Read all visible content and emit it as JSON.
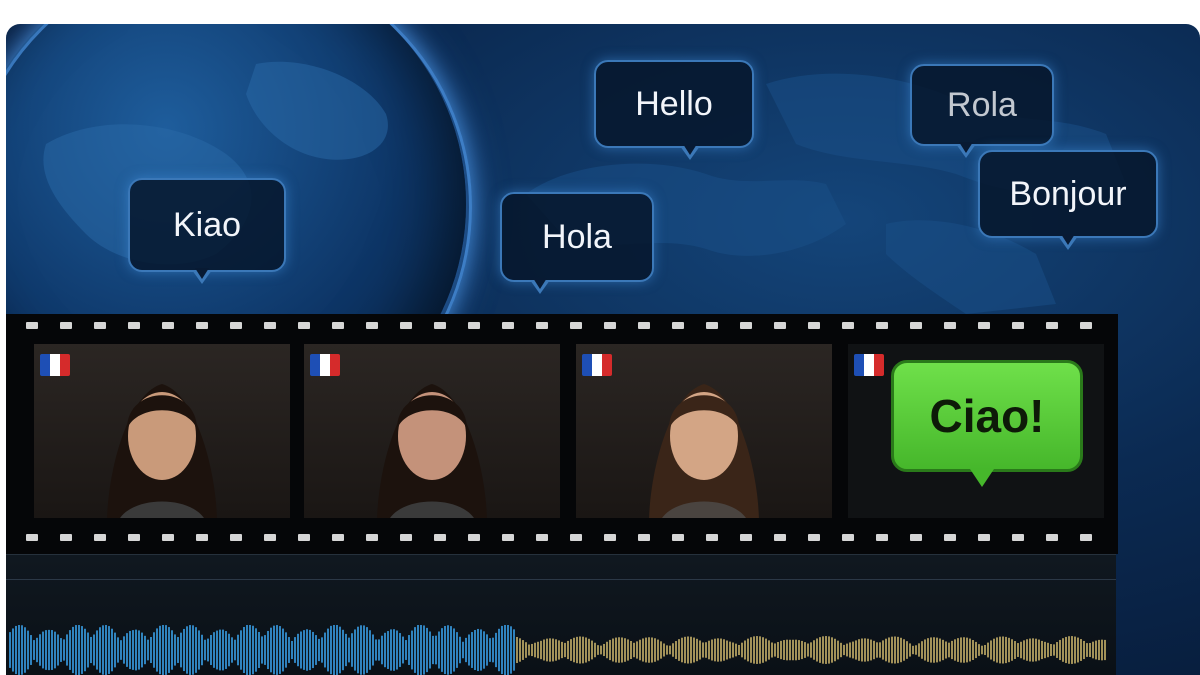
{
  "bubbles": {
    "kiao": "Kiao",
    "hello": "Hello",
    "rola": "Rola",
    "hola": "Hola",
    "bonjour": "Bonjour",
    "ciao": "Ciao!"
  },
  "colors": {
    "background": "#0b2a52",
    "bubble_border": "#3b78b8",
    "ciao_bubble": "#46b72b",
    "waveform_original": "#3aa0e8",
    "waveform_translated": "#c9b26a"
  },
  "icons": [
    "globe-icon",
    "flag-icon",
    "audio-waveform-icon"
  ]
}
